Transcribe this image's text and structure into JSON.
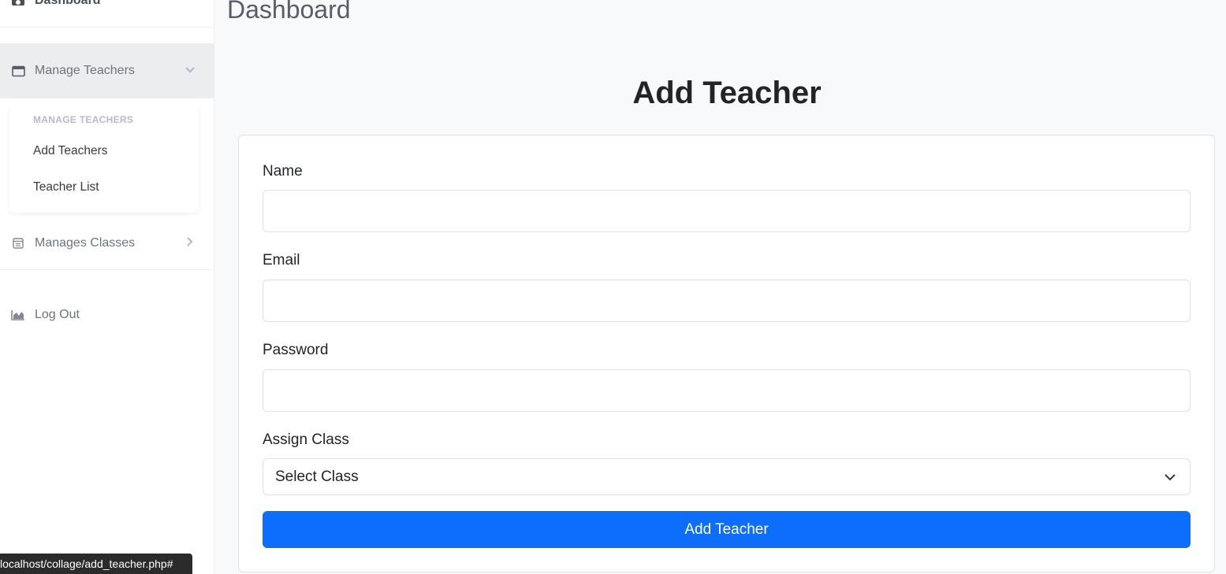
{
  "sidebar": {
    "dashboard_label": "Dashboard",
    "manage_teachers_label": "Manage Teachers",
    "submenu": {
      "header": "MANAGE TEACHERS",
      "items": [
        {
          "label": "Add Teachers"
        },
        {
          "label": "Teacher List"
        }
      ]
    },
    "manage_classes_label": "Manages Classes",
    "logout_label": "Log Out"
  },
  "main": {
    "page_title": "Dashboard",
    "form_heading": "Add Teacher",
    "fields": {
      "name_label": "Name",
      "name_value": "",
      "email_label": "Email",
      "email_value": "",
      "password_label": "Password",
      "password_value": "",
      "class_label": "Assign Class",
      "class_selected": "Select Class"
    },
    "submit_label": "Add Teacher"
  },
  "statusbar": {
    "url": "localhost/collage/add_teacher.php#"
  },
  "colors": {
    "primary": "#0d6efd",
    "sidebar_active_bg": "#ebedef",
    "muted_text": "#6c757d"
  },
  "icons": [
    "tachometer-icon",
    "window-icon",
    "chevron-down-icon",
    "calendar-icon",
    "chevron-right-icon",
    "area-chart-icon",
    "select-caret-icon"
  ]
}
